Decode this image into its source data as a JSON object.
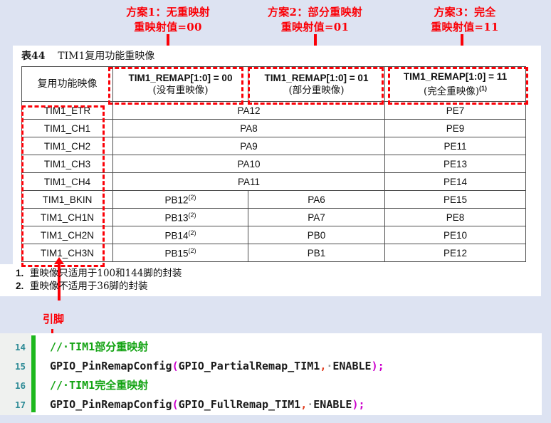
{
  "annotations": {
    "scheme1": "方案1：无重映射\n重映射值=00",
    "scheme2": "方案2：部分重映射\n重映射值=01",
    "scheme3": "方案3：完全\n重映射值=11",
    "pin_label": "引脚",
    "color": "#fb0007"
  },
  "document": {
    "table_title_num": "表44",
    "table_title_text": "TIM1复用功能重映像",
    "table": {
      "headers": {
        "col1": "复用功能映像",
        "col2_line1": "TIM1_REMAP[1:0] = 00",
        "col2_line2": "(没有重映像)",
        "col3_line1": "TIM1_REMAP[1:0] = 01",
        "col3_line2": "(部分重映像)",
        "col4_line1": "TIM1_REMAP[1:0] = 11",
        "col4_line2": "(完全重映像)",
        "col4_sup": "(1)"
      },
      "rows": [
        {
          "name": "TIM1_ETR",
          "merged": true,
          "merged_value": "PA12",
          "c4": "PE7"
        },
        {
          "name": "TIM1_CH1",
          "merged": true,
          "merged_value": "PA8",
          "c4": "PE9"
        },
        {
          "name": "TIM1_CH2",
          "merged": true,
          "merged_value": "PA9",
          "c4": "PE11"
        },
        {
          "name": "TIM1_CH3",
          "merged": true,
          "merged_value": "PA10",
          "c4": "PE13"
        },
        {
          "name": "TIM1_CH4",
          "merged": true,
          "merged_value": "PA11",
          "c4": "PE14"
        },
        {
          "name": "TIM1_BKIN",
          "merged": false,
          "c2": "PB12",
          "c2_sup": "(2)",
          "c3": "PA6",
          "c4": "PE15"
        },
        {
          "name": "TIM1_CH1N",
          "merged": false,
          "c2": "PB13",
          "c2_sup": "(2)",
          "c3": "PA7",
          "c4": "PE8"
        },
        {
          "name": "TIM1_CH2N",
          "merged": false,
          "c2": "PB14",
          "c2_sup": "(2)",
          "c3": "PB0",
          "c4": "PE10"
        },
        {
          "name": "TIM1_CH3N",
          "merged": false,
          "c2": "PB15",
          "c2_sup": "(2)",
          "c3": "PB1",
          "c4": "PE12"
        }
      ]
    },
    "footnotes": [
      {
        "num": "1.",
        "text": "重映像只适用于100和144脚的封装"
      },
      {
        "num": "2.",
        "text": "重映像不适用于36脚的封装"
      }
    ]
  },
  "code": {
    "line_numbers": [
      "14",
      "15",
      "16",
      "17"
    ],
    "lines": [
      {
        "type": "comment",
        "text": "//·TIM1部分重映射"
      },
      {
        "type": "call",
        "fn": "GPIO_PinRemapConfig",
        "open": "(",
        "arg1": "GPIO_PartialRemap_TIM1",
        "comma": ",",
        "dot": "·",
        "arg2": "ENABLE",
        "close": ")",
        "semi": ";"
      },
      {
        "type": "comment",
        "text": "//·TIM1完全重映射"
      },
      {
        "type": "call",
        "fn": "GPIO_PinRemapConfig",
        "open": "(",
        "arg1": "GPIO_FullRemap_TIM1",
        "comma": ",",
        "dot": "·",
        "arg2": "ENABLE",
        "close": ")",
        "semi": ";"
      }
    ],
    "colors": {
      "comment": "#12a312",
      "paren": "#cc00cc",
      "comma": "#e23c1d",
      "lineno": "#2e8b96",
      "marker_bar": "#1db81d"
    }
  },
  "background_color": "#dde3f2"
}
